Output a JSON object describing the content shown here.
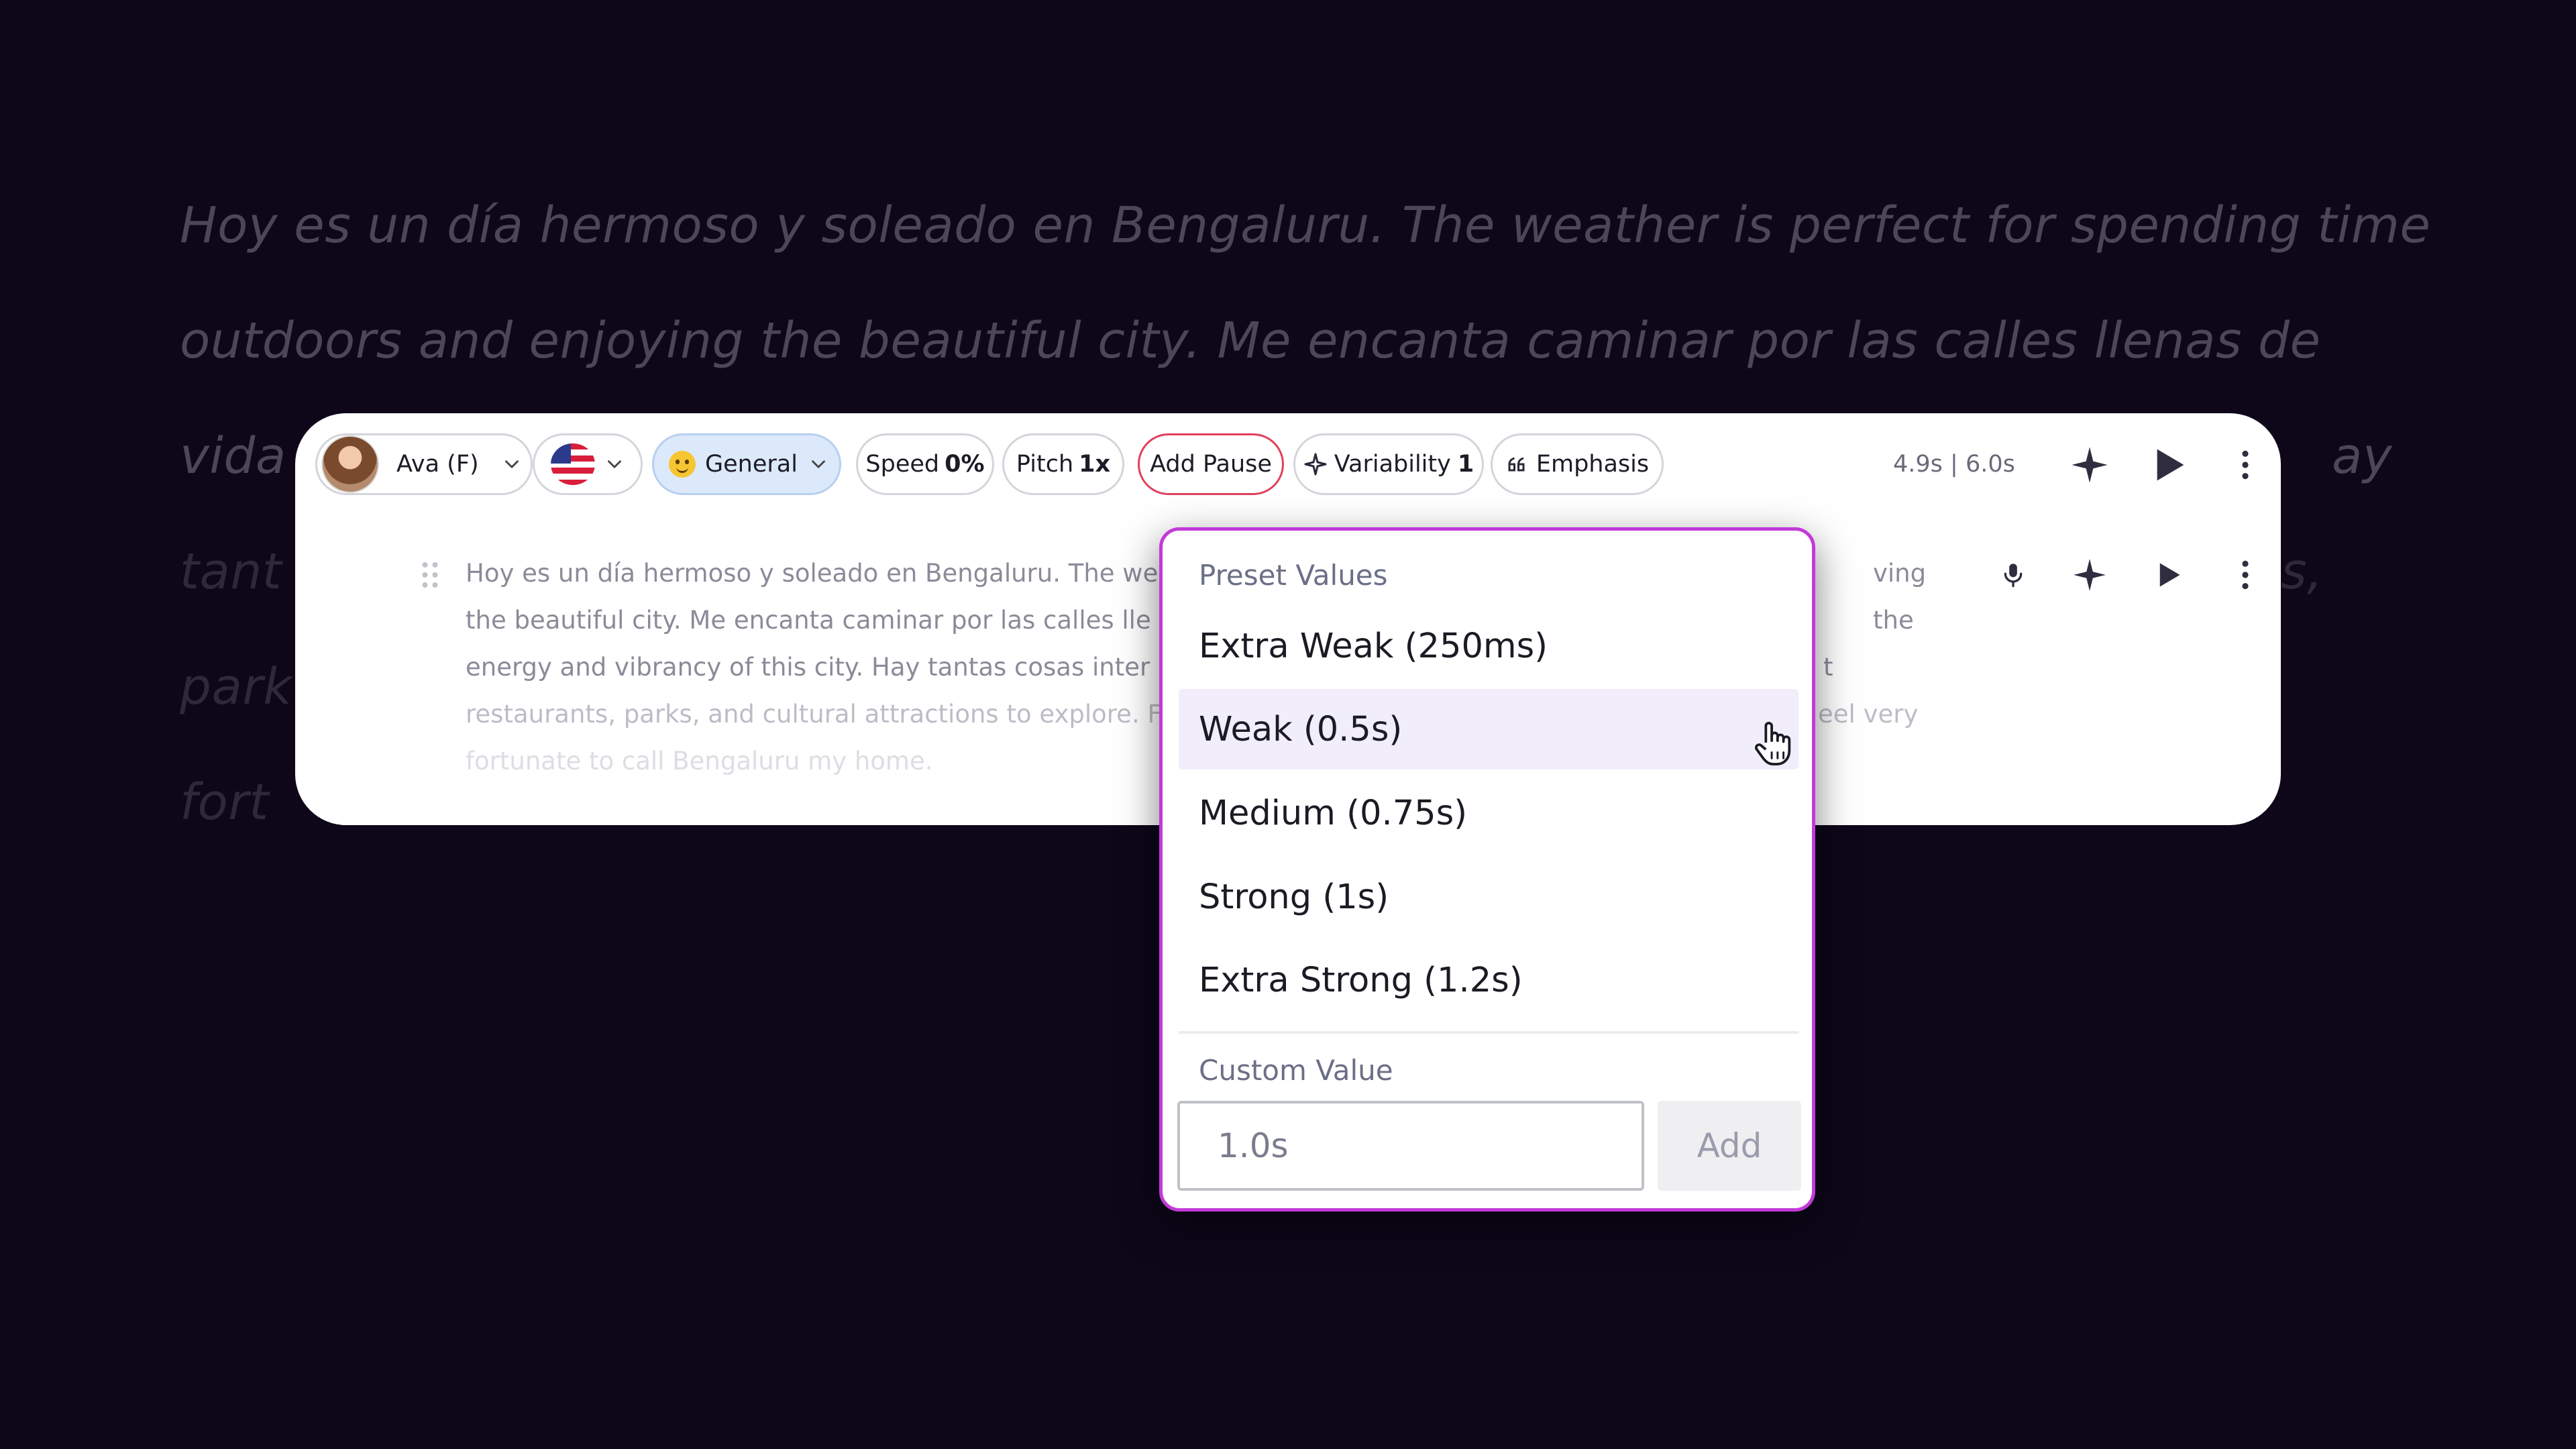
{
  "background_paragraph": {
    "lines": [
      "Hoy es un día hermoso y soleado en Bengaluru. The weather is perfect for spending time",
      "outdoors and enjoying the beautiful city. Me encanta caminar por las calles llenas de",
      "vida",
      "tant",
      "park",
      "fort"
    ],
    "right_fragments": [
      "ay",
      "s,"
    ]
  },
  "toolbar": {
    "voice_name": "Ava (F)",
    "style_label": "General",
    "speed_label": "Speed",
    "speed_value": "0%",
    "pitch_label": "Pitch",
    "pitch_value": "1x",
    "add_pause_label": "Add Pause",
    "variability_label": "Variability",
    "variability_value": "1",
    "emphasis_label": "Emphasis",
    "duration": "4.9s | 6.0s"
  },
  "block": {
    "lines": [
      "Hoy es un día hermoso y soleado en Bengaluru. The we",
      "the beautiful city. Me encanta caminar por las calles lle",
      "energy and vibrancy of this city. Hay tantas cosas inter",
      "restaurants, parks, and cultural attractions to explore. F",
      "fortunate to call Bengaluru my home."
    ],
    "right_lines": [
      "ving",
      "the",
      "t",
      "eel very"
    ]
  },
  "pause_dropdown": {
    "preset_heading": "Preset Values",
    "options": [
      "Extra Weak (250ms)",
      "Weak (0.5s)",
      "Medium (0.75s)",
      "Strong (1s)",
      "Extra Strong (1.2s)"
    ],
    "hovered_option": "Weak (0.5s)",
    "custom_heading": "Custom Value",
    "custom_placeholder": "1.0s",
    "add_label": "Add"
  },
  "colors": {
    "background": "#0d0719",
    "dropdown_border": "#c23ad8",
    "add_pause_border": "#e0405c",
    "style_chip_bg": "#dbe9fb",
    "hover_bg": "#f1edfb"
  }
}
